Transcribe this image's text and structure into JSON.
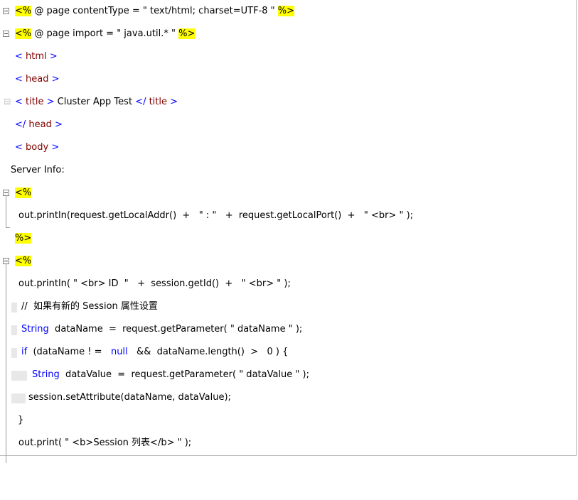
{
  "lines": [
    [
      "<%",
      " @ page contentType = \" text/html; charset=UTF-8 \" ",
      "%>"
    ],
    [
      "<%",
      " @ page import = \" java.util.* \" ",
      "%>"
    ],
    [
      "<",
      " html ",
      ">"
    ],
    [
      "<",
      " head ",
      ">"
    ],
    [
      "<",
      " title ",
      ">",
      " Cluster App Test ",
      "</",
      " title ",
      ">"
    ],
    [
      "</",
      " head ",
      ">"
    ],
    [
      "<",
      " body ",
      ">"
    ],
    [
      "Server Info:"
    ],
    [
      "<%"
    ],
    [
      "out.println(request.getLocalAddr()  +   \" : \"   +  request.getLocalPort()  +   \" <br> \" );"
    ],
    [
      "%>"
    ],
    [
      "<%"
    ],
    [
      "out.println( \" <br> ID  \"   +  session.getId()  +   \" <br> \" );"
    ],
    [
      "//  如果有新的 Session 属性设置"
    ],
    [
      "String",
      "  dataName  =  request.getParameter( \" dataName \" );"
    ],
    [
      "if",
      "  (dataName ! =   ",
      "null",
      "   &&  dataName.length()  >   0 ) {"
    ],
    [
      "String",
      "  dataValue  =  request.getParameter( \" dataValue \" );"
    ],
    [
      "session.setAttribute(dataName, dataValue);"
    ],
    [
      "}"
    ],
    [
      "out.print( \" <b>Session 列表</b> \" );"
    ]
  ],
  "colors": {
    "highlight": "#ffff00",
    "tag": "#800000",
    "punct": "#0000ff",
    "keyword": "#0000ff",
    "gutter_line": "#9a9a9a"
  },
  "icons": {
    "fold": "collapse-box-icon",
    "bookmark": "breakpoint-icon"
  }
}
